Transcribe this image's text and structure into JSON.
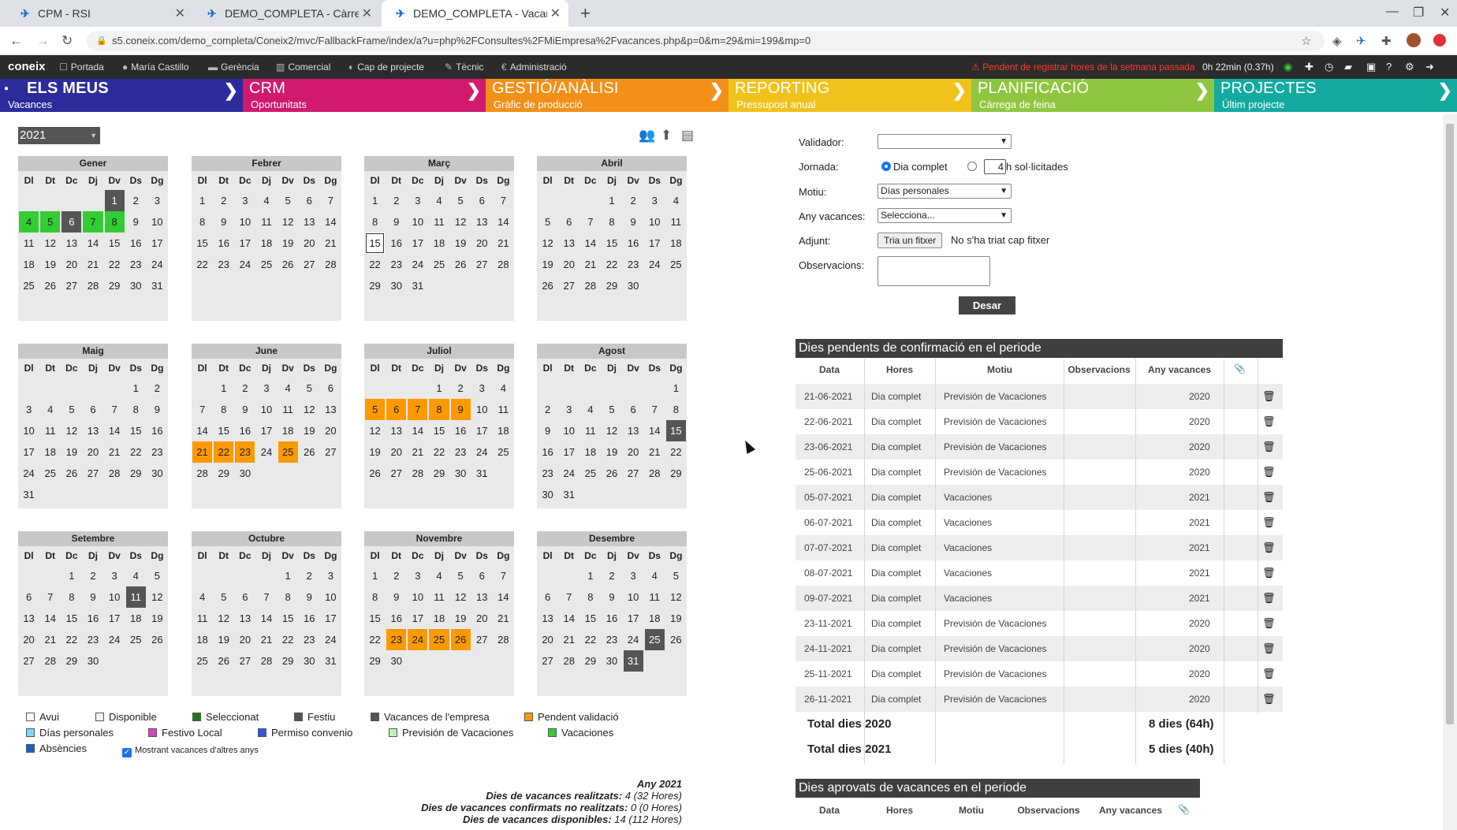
{
  "browser": {
    "tabs": [
      {
        "title": "CPM - RSI"
      },
      {
        "title": "DEMO_COMPLETA - Càrrec"
      },
      {
        "title": "DEMO_COMPLETA - Vacan"
      }
    ],
    "url": "s5.coneix.com/demo_completa/Coneix2/mvc/FallbackFrame/index/a?u=php%2FConsultes%2FMiEmpresa%2Fvacances.php&p=0&m=29&mi=199&mp=0"
  },
  "appbar": {
    "logo": "coneix",
    "menu": [
      "Portada",
      "María Castillo",
      "Gerència",
      "Comercial",
      "Cap de projecte",
      "Tècnic",
      "Administració"
    ],
    "alert": "Pendent de registrar hores de la setmana passada",
    "timer": "0h 22min (0.37h)"
  },
  "modules": [
    {
      "title": "ELS MEUS",
      "sub": "Vacances",
      "color": "#2b2b9c"
    },
    {
      "title": "CRM",
      "sub": "Oportunitats",
      "color": "#d11a6e"
    },
    {
      "title": "GESTIÓ/ANÀLISI",
      "sub": "Gràfic de producció",
      "color": "#f39019"
    },
    {
      "title": "REPORTING",
      "sub": "Pressupost anual",
      "color": "#f2c21c"
    },
    {
      "title": "PLANIFICACIÓ",
      "sub": "Càrrega de feina",
      "color": "#8ec63f"
    },
    {
      "title": "PROJECTES",
      "sub": "Últim projecte",
      "color": "#13aaa0"
    }
  ],
  "year": "2021",
  "weekdays": [
    "Dl",
    "Dt",
    "Dc",
    "Dj",
    "Dv",
    "Ds",
    "Dg"
  ],
  "months": [
    {
      "name": "Gener",
      "offset": 4,
      "days": 31
    },
    {
      "name": "Febrer",
      "offset": 0,
      "days": 28
    },
    {
      "name": "Març",
      "offset": 0,
      "days": 31
    },
    {
      "name": "Abril",
      "offset": 3,
      "days": 30
    },
    {
      "name": "Maig",
      "offset": 5,
      "days": 31
    },
    {
      "name": "June",
      "offset": 1,
      "days": 30
    },
    {
      "name": "Juliol",
      "offset": 3,
      "days": 31
    },
    {
      "name": "Agost",
      "offset": 6,
      "days": 31
    },
    {
      "name": "Setembre",
      "offset": 2,
      "days": 30
    },
    {
      "name": "Octubre",
      "offset": 4,
      "days": 31
    },
    {
      "name": "Novembre",
      "offset": 0,
      "days": 30
    },
    {
      "name": "Desembre",
      "offset": 2,
      "days": 31
    }
  ],
  "day_marks": {
    "0": {
      "1": "x",
      "4": "g",
      "5": "g",
      "6": "x",
      "7": "g",
      "8": "g"
    },
    "2": {
      "15": "t"
    },
    "5": {
      "21": "o",
      "22": "o",
      "23": "o",
      "25": "o"
    },
    "6": {
      "5": "o",
      "6": "o",
      "7": "o",
      "8": "o",
      "9": "o"
    },
    "7": {
      "15": "x"
    },
    "8": {
      "11": "x"
    },
    "10": {
      "23": "o",
      "24": "o",
      "25": "o",
      "26": "o"
    },
    "11": {
      "25": "x",
      "31": "x"
    }
  },
  "legend": [
    {
      "label": "Avui",
      "color": "#ffffff"
    },
    {
      "label": "Disponible",
      "color": "#f4f4f4"
    },
    {
      "label": "Seleccionat",
      "color": "#1a7a1a"
    },
    {
      "label": "Festiu",
      "color": "#555555"
    },
    {
      "label": "Vacances de l'empresa",
      "color": "#555555"
    },
    {
      "label": "Pendent validació",
      "color": "#ff9900"
    },
    {
      "label": "Días personales",
      "color": "#7fd8f0"
    },
    {
      "label": "Festivo Local",
      "color": "#e040c0"
    },
    {
      "label": "Permiso convenio",
      "color": "#3355dd"
    },
    {
      "label": "Previsión de Vacaciones",
      "color": "#bff0bf"
    },
    {
      "label": "Vacaciones",
      "color": "#33cc33"
    },
    {
      "label": "Absències",
      "color": "#1a5fc9"
    }
  ],
  "show_other_years": "Mostrant vacances d'altres anys",
  "summary": {
    "year": "Any 2021",
    "realized_label": "Dies de vacances realitzats:",
    "realized": "4 (32 Hores)",
    "not_realized_label": "Dies de vacances confirmats no realitzats:",
    "not_realized": "0 (0 Hores)",
    "available_label": "Dies de vacances disponibles:",
    "available": "14 (112 Hores)"
  },
  "form": {
    "validator_label": "Validador:",
    "validator_value": "",
    "jornada_label": "Jornada:",
    "full_day": "Dia complet",
    "hours": "4",
    "hours_suffix": "h sol·licitades",
    "motiu_label": "Motiu:",
    "motiu_value": "Días personales",
    "any_label": "Any vacances:",
    "any_value": "Selecciona...",
    "adjunt_label": "Adjunt:",
    "file_button": "Tria un fitxer",
    "file_info": "No s'ha triat cap fitxer",
    "obs_label": "Observacions:",
    "save": "Desar"
  },
  "pending": {
    "title": "Dies pendents de confirmació en el periode",
    "columns": [
      "Data",
      "Hores",
      "Motiu",
      "Observacions",
      "Any vacances"
    ],
    "rows": [
      {
        "date": "21-06-2021",
        "hours": "Dia complet",
        "motiu": "Previsión de Vacaciones",
        "obs": "",
        "year": "2020"
      },
      {
        "date": "22-06-2021",
        "hours": "Dia complet",
        "motiu": "Previsión de Vacaciones",
        "obs": "",
        "year": "2020"
      },
      {
        "date": "23-06-2021",
        "hours": "Dia complet",
        "motiu": "Previsión de Vacaciones",
        "obs": "",
        "year": "2020"
      },
      {
        "date": "25-06-2021",
        "hours": "Dia complet",
        "motiu": "Previsión de Vacaciones",
        "obs": "",
        "year": "2020"
      },
      {
        "date": "05-07-2021",
        "hours": "Dia complet",
        "motiu": "Vacaciones",
        "obs": "",
        "year": "2021"
      },
      {
        "date": "06-07-2021",
        "hours": "Dia complet",
        "motiu": "Vacaciones",
        "obs": "",
        "year": "2021"
      },
      {
        "date": "07-07-2021",
        "hours": "Dia complet",
        "motiu": "Vacaciones",
        "obs": "",
        "year": "2021"
      },
      {
        "date": "08-07-2021",
        "hours": "Dia complet",
        "motiu": "Vacaciones",
        "obs": "",
        "year": "2021"
      },
      {
        "date": "09-07-2021",
        "hours": "Dia complet",
        "motiu": "Vacaciones",
        "obs": "",
        "year": "2021"
      },
      {
        "date": "23-11-2021",
        "hours": "Dia complet",
        "motiu": "Previsión de Vacaciones",
        "obs": "",
        "year": "2020"
      },
      {
        "date": "24-11-2021",
        "hours": "Dia complet",
        "motiu": "Previsión de Vacaciones",
        "obs": "",
        "year": "2020"
      },
      {
        "date": "25-11-2021",
        "hours": "Dia complet",
        "motiu": "Previsión de Vacaciones",
        "obs": "",
        "year": "2020"
      },
      {
        "date": "26-11-2021",
        "hours": "Dia complet",
        "motiu": "Previsión de Vacaciones",
        "obs": "",
        "year": "2020"
      }
    ],
    "totals": [
      {
        "label": "Total dies 2020",
        "value": "8 dies (64h)"
      },
      {
        "label": "Total dies 2021",
        "value": "5 dies (40h)"
      }
    ]
  },
  "approved": {
    "title": "Dies aprovats de vacances en el periode",
    "columns": [
      "Data",
      "Hores",
      "Motiu",
      "Observacions",
      "Any vacances"
    ]
  }
}
